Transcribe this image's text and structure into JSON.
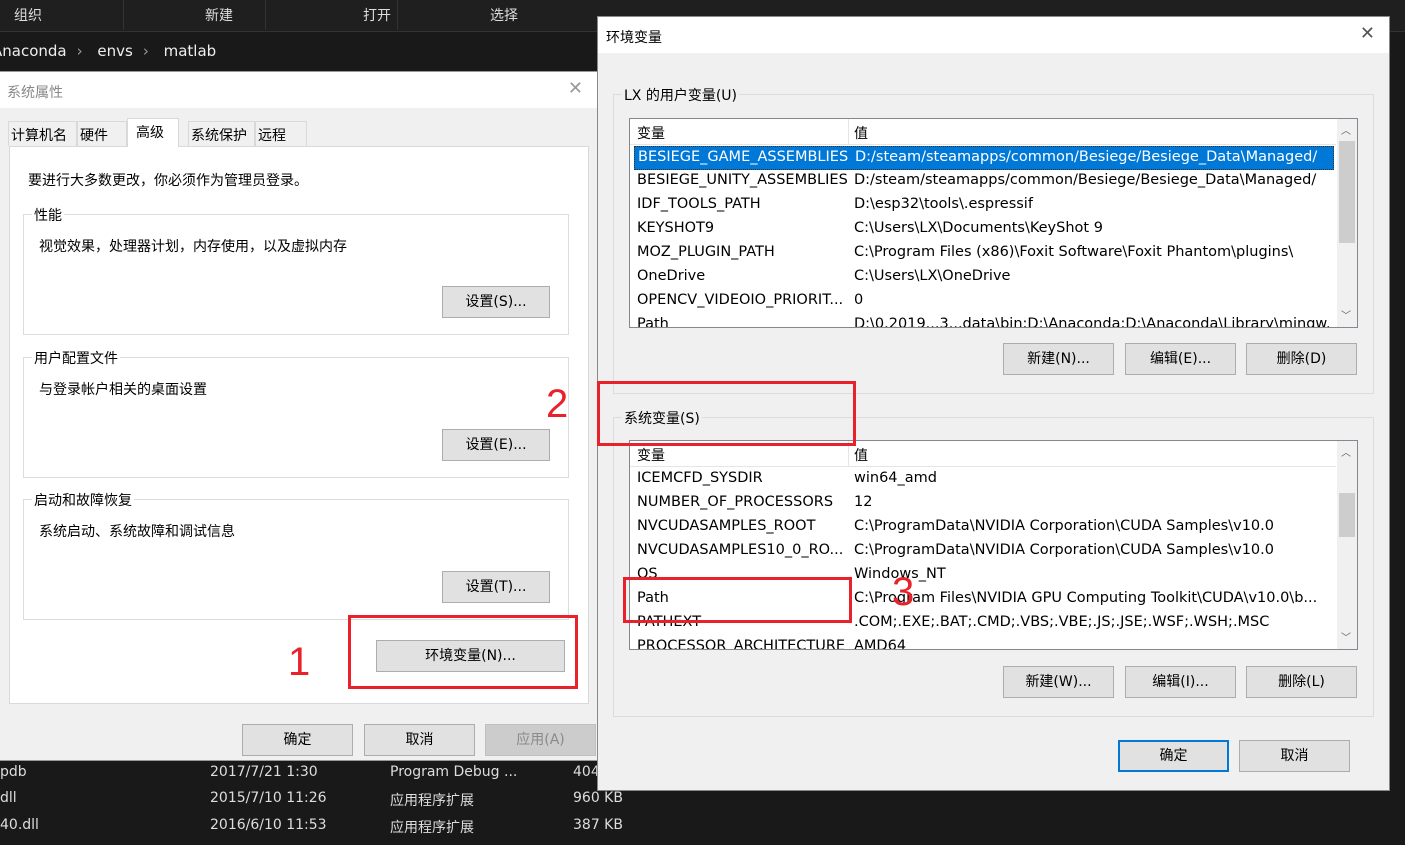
{
  "explorer": {
    "toolbar": [
      "组织",
      "新建",
      "打开",
      "选择"
    ],
    "breadcrumb": [
      "Anaconda",
      "envs",
      "matlab"
    ],
    "files": [
      {
        "name": "pdb",
        "date": "2017/7/21 1:30",
        "type": "Program Debug ...",
        "size": "404"
      },
      {
        "name": "dll",
        "date": "2015/7/10 11:26",
        "type": "应用程序扩展",
        "size": "960 KB"
      },
      {
        "name": "40.dll",
        "date": "2016/6/10 11:53",
        "type": "应用程序扩展",
        "size": "387 KB"
      }
    ]
  },
  "sysprops": {
    "title": "系统属性",
    "tabs": [
      "计算机名",
      "硬件",
      "高级",
      "系统保护",
      "远程"
    ],
    "active_tab": "高级",
    "admin_note": "要进行大多数更改，你必须作为管理员登录。",
    "groups": [
      {
        "label": "性能",
        "desc": "视觉效果，处理器计划，内存使用，以及虚拟内存",
        "button": "设置(S)..."
      },
      {
        "label": "用户配置文件",
        "desc": "与登录帐户相关的桌面设置",
        "button": "设置(E)..."
      },
      {
        "label": "启动和故障恢复",
        "desc": "系统启动、系统故障和调试信息",
        "button": "设置(T)..."
      }
    ],
    "env_button": "环境变量(N)...",
    "ok": "确定",
    "cancel": "取消",
    "apply": "应用(A)"
  },
  "envvars": {
    "title": "环境变量",
    "user_group": "LX 的用户变量(U)",
    "sys_group": "系统变量(S)",
    "col_var": "变量",
    "col_val": "值",
    "user_vars": [
      {
        "name": "BESIEGE_GAME_ASSEMBLIES",
        "value": "D:/steam/steamapps/common/Besiege/Besiege_Data\\Managed/",
        "selected": true
      },
      {
        "name": "BESIEGE_UNITY_ASSEMBLIES",
        "value": "D:/steam/steamapps/common/Besiege/Besiege_Data\\Managed/"
      },
      {
        "name": "IDF_TOOLS_PATH",
        "value": "D:\\esp32\\tools\\.espressif"
      },
      {
        "name": "KEYSHOT9",
        "value": "C:\\Users\\LX\\Documents\\KeyShot 9"
      },
      {
        "name": "MOZ_PLUGIN_PATH",
        "value": "C:\\Program Files (x86)\\Foxit Software\\Foxit Phantom\\plugins\\"
      },
      {
        "name": "OneDrive",
        "value": "C:\\Users\\LX\\OneDrive"
      },
      {
        "name": "OPENCV_VIDEOIO_PRIORIT...",
        "value": "0"
      },
      {
        "name": "Path",
        "value": "D:\\0.2019...3...data\\bin;D:\\Anaconda;D:\\Anaconda\\Library\\mingw..."
      }
    ],
    "sys_vars": [
      {
        "name": "ICEMCFD_SYSDIR",
        "value": "win64_amd"
      },
      {
        "name": "NUMBER_OF_PROCESSORS",
        "value": "12"
      },
      {
        "name": "NVCUDASAMPLES_ROOT",
        "value": "C:\\ProgramData\\NVIDIA Corporation\\CUDA Samples\\v10.0"
      },
      {
        "name": "NVCUDASAMPLES10_0_RO...",
        "value": "C:\\ProgramData\\NVIDIA Corporation\\CUDA Samples\\v10.0"
      },
      {
        "name": "OS",
        "value": "Windows_NT"
      },
      {
        "name": "Path",
        "value": "C:\\Program Files\\NVIDIA GPU Computing Toolkit\\CUDA\\v10.0\\b..."
      },
      {
        "name": "PATHEXT",
        "value": ".COM;.EXE;.BAT;.CMD;.VBS;.VBE;.JS;.JSE;.WSF;.WSH;.MSC"
      },
      {
        "name": "PROCESSOR_ARCHITECTURE",
        "value": "AMD64"
      }
    ],
    "user_buttons": [
      "新建(N)...",
      "编辑(E)...",
      "删除(D)"
    ],
    "sys_buttons": [
      "新建(W)...",
      "编辑(I)...",
      "删除(L)"
    ],
    "ok": "确定",
    "cancel": "取消"
  },
  "annotations": {
    "step1": "1",
    "step2": "2",
    "step3": "3",
    "color": "#e8212b"
  }
}
